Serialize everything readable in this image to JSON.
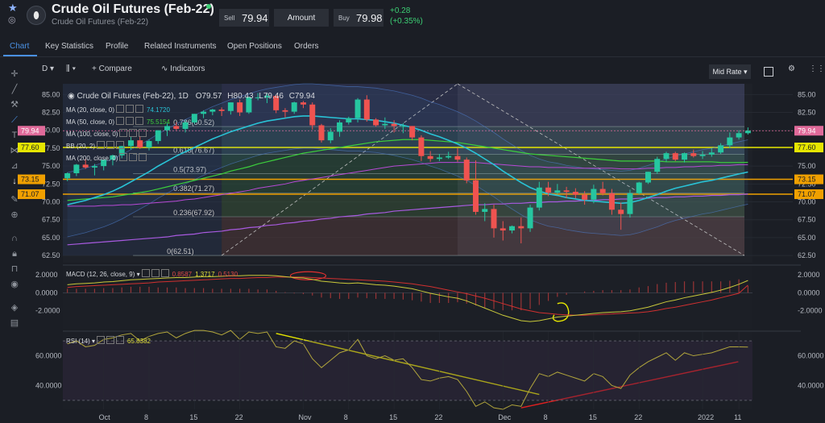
{
  "header": {
    "title": "Crude Oil Futures (Feb-22)",
    "subtitle": "Crude Oil Futures (Feb-22)",
    "sell_label": "Sell",
    "sell_value": "79.94",
    "amount_label": "Amount",
    "buy_label": "Buy",
    "buy_value": "79.98",
    "change_abs": "+0.28",
    "change_pct": "(+0.35%)",
    "status_color": "#3ccf74"
  },
  "tabs": [
    {
      "label": "Chart",
      "active": true
    },
    {
      "label": "Key Statistics"
    },
    {
      "label": "Profile"
    },
    {
      "label": "Related Instruments"
    },
    {
      "label": "Open Positions"
    },
    {
      "label": "Orders"
    }
  ],
  "toolbar": {
    "timeframe": "D",
    "compare_label": "Compare",
    "indicators_label": "Indicators",
    "price_mode": "Mid Rate"
  },
  "left_tools": [
    "crosshair-icon",
    "line-icon",
    "fib-icon",
    "trend-icon",
    "text-icon",
    "pattern-icon",
    "measure-icon",
    "arrow-icon",
    "pencil-icon",
    "zoom-icon",
    "magnet-icon",
    "lock-icon",
    "lock-open-icon",
    "eye-icon",
    "layers-icon",
    "trash-icon"
  ],
  "price_legend": {
    "name": "Crude Oil Futures (Feb-22), 1D",
    "o": "O79.57",
    "h": "H80.43",
    "l": "L79.46",
    "c": "C79.94",
    "ma20_label": "MA (20, close, 0)",
    "ma20_value": "74.1720",
    "ma50_label": "MA (50, close, 0)",
    "ma50_value": "75.5154",
    "ma100_label": "MA (100, close, 0)",
    "bb_label": "BB (20, 2)",
    "ma200_label": "MA (200, close, 0)"
  },
  "price_axis": [
    "85.00",
    "82.50",
    "80.00",
    "77.50",
    "75.00",
    "72.50",
    "70.00",
    "67.50",
    "65.00",
    "62.50"
  ],
  "price_tags": [
    {
      "value": "79.94",
      "color": "#e06a9a"
    },
    {
      "value": "77.60",
      "color": "#e6e600"
    },
    {
      "value": "73.15",
      "color": "#f0a000"
    },
    {
      "value": "71.07",
      "color": "#f0a000"
    }
  ],
  "fib_labels": [
    "0.786(80.52)",
    "0.618(76.67)",
    "0.5(73.97)",
    "0.382(71.27)",
    "0.236(67.92)",
    "0(62.51)"
  ],
  "macd": {
    "label": "MACD (12, 26, close, 9)",
    "v1": "0.8587",
    "v2": "1.3717",
    "v3": "0.5130",
    "axis": [
      "2.0000",
      "0.0000",
      "-2.0000"
    ]
  },
  "rsi": {
    "label": "RSI (14)",
    "value": "65.8382",
    "axis": [
      "60.0000",
      "40.0000"
    ]
  },
  "date_axis": [
    "Oct",
    "8",
    "15",
    "22",
    "Nov",
    "8",
    "15",
    "22",
    "Dec",
    "8",
    "15",
    "22",
    "2022",
    "11"
  ],
  "colors": {
    "up": "#26c6a0",
    "down": "#ef5350",
    "ma20": "#29c3d6",
    "ma50": "#3ccf3c",
    "ma100": "#b84ad6",
    "ma200": "#a85ae0",
    "macd": "#c9c93a",
    "signal": "#d03030",
    "rsi": "#b2a63c"
  },
  "chart_data": {
    "type": "candlestick",
    "x": [
      "Sep-24",
      "Sep-27",
      "Sep-28",
      "Sep-29",
      "Sep-30",
      "Oct-1",
      "Oct-4",
      "Oct-5",
      "Oct-6",
      "Oct-7",
      "Oct-8",
      "Oct-11",
      "Oct-12",
      "Oct-13",
      "Oct-14",
      "Oct-15",
      "Oct-18",
      "Oct-19",
      "Oct-20",
      "Oct-21",
      "Oct-22",
      "Oct-25",
      "Oct-26",
      "Oct-27",
      "Oct-28",
      "Oct-29",
      "Nov-1",
      "Nov-2",
      "Nov-3",
      "Nov-4",
      "Nov-5",
      "Nov-8",
      "Nov-9",
      "Nov-10",
      "Nov-11",
      "Nov-12",
      "Nov-15",
      "Nov-16",
      "Nov-17",
      "Nov-18",
      "Nov-19",
      "Nov-22",
      "Nov-23",
      "Nov-24",
      "Nov-25",
      "Nov-26",
      "Nov-29",
      "Nov-30",
      "Dec-1",
      "Dec-2",
      "Dec-3",
      "Dec-6",
      "Dec-7",
      "Dec-8",
      "Dec-9",
      "Dec-10",
      "Dec-13",
      "Dec-14",
      "Dec-15",
      "Dec-16",
      "Dec-17",
      "Dec-20",
      "Dec-21",
      "Dec-22",
      "Dec-23",
      "Dec-24",
      "Dec-27",
      "Dec-28",
      "Dec-29",
      "Dec-30",
      "Dec-31",
      "Jan-3",
      "Jan-4",
      "Jan-5",
      "Jan-6",
      "Jan-7"
    ],
    "open": [
      73.3,
      74.0,
      75.2,
      74.8,
      75.0,
      75.9,
      76.5,
      77.8,
      78.6,
      77.6,
      78.5,
      80.0,
      80.6,
      80.2,
      81.1,
      82.3,
      82.6,
      82.9,
      82.7,
      83.9,
      82.5,
      84.6,
      84.6,
      84.8,
      82.8,
      82.6,
      83.9,
      83.6,
      80.7,
      78.6,
      79.8,
      81.1,
      81.7,
      84.3,
      81.5,
      80.7,
      80.9,
      80.6,
      80.6,
      79.0,
      76.4,
      76.0,
      76.2,
      76.4,
      75.9,
      73.0,
      68.6,
      69.0,
      66.3,
      66.0,
      66.6,
      66.3,
      69.2,
      72.0,
      71.3,
      71.6,
      71.4,
      71.0,
      70.3,
      71.8,
      71.2,
      68.9,
      68.3,
      71.2,
      72.7,
      74.2,
      76.0,
      76.8,
      75.9,
      76.8,
      76.4,
      76.6,
      76.9,
      77.9,
      79.0,
      79.6
    ],
    "high": [
      74.1,
      75.3,
      76.0,
      75.3,
      75.5,
      76.6,
      77.8,
      79.1,
      79.2,
      78.7,
      80.0,
      81.0,
      81.1,
      81.4,
      82.3,
      82.8,
      83.0,
      83.2,
      83.9,
      84.3,
      84.7,
      85.2,
      85.2,
      85.0,
      83.1,
      84.0,
      84.1,
      83.9,
      80.9,
      80.3,
      81.4,
      81.9,
      84.5,
      84.9,
      81.7,
      81.8,
      81.4,
      81.0,
      80.6,
      79.3,
      77.1,
      76.7,
      77.0,
      77.5,
      76.2,
      75.8,
      69.8,
      69.6,
      67.3,
      66.7,
      67.8,
      69.6,
      72.8,
      72.8,
      72.5,
      72.1,
      71.9,
      71.5,
      72.4,
      72.8,
      71.8,
      69.9,
      71.7,
      72.8,
      74.2,
      76.3,
      77.0,
      77.0,
      76.9,
      77.3,
      77.1,
      77.5,
      78.2,
      79.7,
      80.0,
      80.4
    ],
    "low": [
      72.9,
      73.6,
      74.6,
      73.7,
      74.4,
      75.1,
      76.1,
      77.3,
      77.4,
      77.2,
      78.1,
      79.2,
      80.0,
      79.7,
      80.9,
      81.7,
      82.1,
      82.0,
      82.2,
      82.0,
      82.3,
      84.2,
      83.8,
      82.4,
      81.8,
      82.3,
      83.1,
      80.1,
      78.3,
      78.2,
      79.1,
      80.8,
      81.1,
      81.2,
      80.5,
      80.2,
      79.7,
      79.6,
      78.6,
      75.7,
      75.6,
      75.7,
      76.0,
      75.6,
      72.6,
      68.2,
      67.3,
      65.0,
      64.6,
      65.6,
      64.2,
      65.8,
      68.8,
      70.8,
      71.1,
      70.5,
      70.5,
      69.6,
      69.8,
      70.9,
      68.2,
      66.1,
      67.8,
      71.0,
      72.5,
      73.9,
      75.6,
      75.7,
      75.5,
      76.2,
      76.0,
      76.3,
      76.7,
      77.5,
      78.7,
      79.4
    ],
    "close": [
      74.0,
      75.2,
      74.8,
      75.0,
      75.9,
      76.5,
      77.8,
      78.6,
      77.6,
      78.5,
      80.0,
      80.6,
      80.2,
      81.1,
      82.3,
      82.6,
      82.9,
      82.7,
      83.9,
      82.5,
      84.6,
      84.6,
      84.8,
      82.8,
      82.6,
      83.9,
      83.6,
      80.7,
      78.6,
      79.8,
      81.1,
      81.7,
      84.3,
      81.5,
      80.7,
      80.9,
      80.6,
      80.6,
      79.0,
      76.4,
      76.0,
      76.2,
      76.4,
      75.9,
      73.0,
      68.6,
      69.0,
      66.3,
      66.0,
      66.6,
      66.3,
      69.2,
      72.0,
      71.3,
      71.6,
      71.4,
      71.0,
      70.3,
      71.8,
      71.2,
      68.9,
      68.3,
      71.2,
      72.7,
      74.2,
      76.0,
      76.8,
      75.9,
      76.8,
      76.4,
      76.6,
      76.9,
      77.9,
      79.0,
      79.6,
      79.94
    ],
    "ma20": [
      69.6,
      69.9,
      70.2,
      70.6,
      71.0,
      71.5,
      72.1,
      72.8,
      73.5,
      74.2,
      75.0,
      75.7,
      76.4,
      77.0,
      77.6,
      78.2,
      78.8,
      79.3,
      79.8,
      80.2,
      80.6,
      81.0,
      81.3,
      81.5,
      81.7,
      81.9,
      82.0,
      82.0,
      81.9,
      81.8,
      81.7,
      81.6,
      81.6,
      81.5,
      81.4,
      81.2,
      81.0,
      80.7,
      80.4,
      80.0,
      79.5,
      79.1,
      78.6,
      78.1,
      77.5,
      76.8,
      76.0,
      75.2,
      74.3,
      73.5,
      72.7,
      72.0,
      71.5,
      71.1,
      70.9,
      70.6,
      70.4,
      70.2,
      70.1,
      70.0,
      69.9,
      69.8,
      69.9,
      70.2,
      70.6,
      71.0,
      71.5,
      71.9,
      72.2,
      72.5,
      72.8,
      73.0,
      73.3,
      73.6,
      73.9,
      74.17
    ],
    "ma50": [
      70.2,
      70.3,
      70.4,
      70.5,
      70.6,
      70.7,
      70.9,
      71.1,
      71.3,
      71.5,
      71.8,
      72.1,
      72.4,
      72.7,
      73.0,
      73.3,
      73.6,
      73.9,
      74.3,
      74.6,
      74.9,
      75.3,
      75.6,
      75.9,
      76.2,
      76.5,
      76.8,
      77.0,
      77.2,
      77.4,
      77.6,
      77.8,
      78.0,
      78.2,
      78.4,
      78.5,
      78.6,
      78.7,
      78.7,
      78.7,
      78.6,
      78.5,
      78.4,
      78.3,
      78.1,
      77.9,
      77.7,
      77.5,
      77.3,
      77.1,
      76.9,
      76.7,
      76.6,
      76.5,
      76.4,
      76.3,
      76.2,
      76.1,
      76.0,
      75.9,
      75.8,
      75.7,
      75.7,
      75.7,
      75.7,
      75.7,
      75.6,
      75.6,
      75.6,
      75.6,
      75.6,
      75.6,
      75.5,
      75.5,
      75.5,
      75.52
    ],
    "ma100": [
      69.4,
      69.4,
      69.4,
      69.4,
      69.5,
      69.5,
      69.6,
      69.6,
      69.7,
      69.8,
      69.9,
      70.0,
      70.1,
      70.3,
      70.4,
      70.6,
      70.8,
      71.0,
      71.2,
      71.4,
      71.6,
      71.9,
      72.1,
      72.3,
      72.5,
      72.8,
      73.0,
      73.2,
      73.4,
      73.6,
      73.8,
      74.0,
      74.2,
      74.4,
      74.6,
      74.8,
      75.0,
      75.1,
      75.2,
      75.3,
      75.4,
      75.5,
      75.5,
      75.5,
      75.5,
      75.5,
      75.4,
      75.3,
      75.2,
      75.1,
      75.0,
      74.9,
      74.9,
      74.8,
      74.8,
      74.8,
      74.7,
      74.7,
      74.7,
      74.7,
      74.7,
      74.6,
      74.6,
      74.6,
      74.7,
      74.7,
      74.8,
      74.8,
      74.9,
      74.9,
      75.0,
      75.0,
      75.1,
      75.1,
      75.2,
      75.2
    ],
    "ma200": [
      64.0,
      64.1,
      64.2,
      64.3,
      64.4,
      64.5,
      64.6,
      64.7,
      64.8,
      64.9,
      65.0,
      65.1,
      65.3,
      65.4,
      65.5,
      65.7,
      65.8,
      65.9,
      66.1,
      66.2,
      66.4,
      66.5,
      66.7,
      66.8,
      67.0,
      67.1,
      67.3,
      67.4,
      67.6,
      67.7,
      67.9,
      68.0,
      68.1,
      68.3,
      68.4,
      68.5,
      68.7,
      68.8,
      68.9,
      69.0,
      69.1,
      69.2,
      69.3,
      69.4,
      69.5,
      69.6,
      69.6,
      69.7,
      69.7,
      69.8,
      69.8,
      69.9,
      69.9,
      70.0,
      70.0,
      70.1,
      70.1,
      70.2,
      70.2,
      70.3,
      70.3,
      70.4,
      70.4,
      70.5,
      70.5,
      70.6,
      70.6,
      70.7,
      70.7,
      70.8,
      70.8,
      70.9,
      70.9,
      71.0,
      71.0,
      71.1
    ],
    "macd": [
      0.9,
      1.0,
      1.05,
      1.1,
      1.2,
      1.25,
      1.35,
      1.45,
      1.5,
      1.55,
      1.6,
      1.65,
      1.7,
      1.7,
      1.75,
      1.8,
      1.8,
      1.85,
      1.9,
      1.9,
      1.95,
      1.95,
      1.95,
      1.9,
      1.8,
      1.7,
      1.65,
      1.5,
      1.3,
      1.2,
      1.1,
      1.05,
      1.1,
      1.0,
      0.9,
      0.85,
      0.75,
      0.6,
      0.45,
      0.2,
      -0.05,
      -0.25,
      -0.45,
      -0.6,
      -0.9,
      -1.3,
      -1.7,
      -2.1,
      -2.5,
      -2.8,
      -3.1,
      -3.2,
      -3.1,
      -2.9,
      -2.7,
      -2.6,
      -2.5,
      -2.4,
      -2.3,
      -2.2,
      -2.15,
      -2.1,
      -2.0,
      -1.8,
      -1.6,
      -1.3,
      -1.0,
      -0.8,
      -0.55,
      -0.35,
      -0.15,
      0.05,
      0.3,
      0.6,
      0.95,
      1.3717
    ],
    "signal": [
      0.6,
      0.7,
      0.75,
      0.8,
      0.85,
      0.9,
      0.95,
      1.0,
      1.05,
      1.1,
      1.2,
      1.25,
      1.3,
      1.35,
      1.4,
      1.45,
      1.5,
      1.55,
      1.6,
      1.6,
      1.65,
      1.7,
      1.7,
      1.75,
      1.75,
      1.75,
      1.75,
      1.7,
      1.65,
      1.6,
      1.55,
      1.5,
      1.45,
      1.4,
      1.35,
      1.3,
      1.2,
      1.1,
      1.0,
      0.85,
      0.7,
      0.5,
      0.3,
      0.1,
      -0.1,
      -0.35,
      -0.6,
      -0.9,
      -1.2,
      -1.5,
      -1.8,
      -2.0,
      -2.2,
      -2.3,
      -2.4,
      -2.45,
      -2.5,
      -2.5,
      -2.45,
      -2.4,
      -2.35,
      -2.3,
      -2.25,
      -2.2,
      -2.1,
      -1.95,
      -1.75,
      -1.6,
      -1.4,
      -1.2,
      -1.0,
      -0.8,
      -0.55,
      -0.3,
      -0.05,
      0.8587
    ],
    "rsi": [
      68,
      70,
      66,
      67,
      71,
      72,
      74,
      75,
      70,
      73,
      75,
      76,
      72,
      75,
      77,
      77,
      76,
      74,
      77,
      71,
      76,
      75,
      76,
      66,
      65,
      70,
      68,
      58,
      52,
      57,
      62,
      64,
      71,
      60,
      58,
      60,
      57,
      58,
      52,
      44,
      43,
      45,
      46,
      44,
      36,
      26,
      29,
      25,
      24,
      27,
      26,
      38,
      48,
      46,
      49,
      47,
      45,
      43,
      48,
      46,
      40,
      38,
      47,
      52,
      56,
      59,
      62,
      57,
      62,
      60,
      61,
      62,
      64,
      66,
      66,
      65.84
    ]
  }
}
